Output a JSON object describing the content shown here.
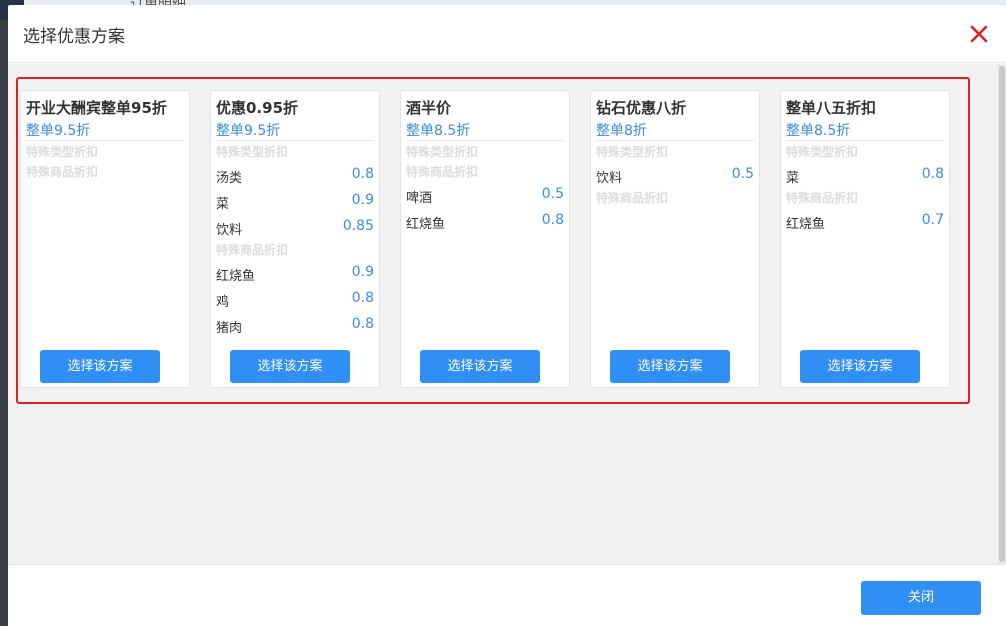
{
  "background": {
    "partial_title": "订单明细"
  },
  "modal": {
    "title": "选择优惠方案",
    "close_button_label": "关闭",
    "select_button_label": "选择该方案",
    "type_section_label": "特殊类型折扣",
    "goods_section_label": "特殊商品折扣"
  },
  "colors": {
    "accent": "#2f8ff5",
    "value_text": "#3b8de6",
    "highlight_frame": "#e02020",
    "close_icon": "#e02020"
  },
  "icons": {
    "close": "close-icon"
  },
  "plans": [
    {
      "name": "开业大酬宾整单95折",
      "overall": "整单9.5折",
      "type_discounts": [],
      "goods_discounts": []
    },
    {
      "name": "优惠0.95折",
      "overall": "整单9.5折",
      "type_discounts": [
        {
          "name": "汤类",
          "value": "0.8"
        },
        {
          "name": "菜",
          "value": "0.9"
        },
        {
          "name": "饮料",
          "value": "0.85"
        }
      ],
      "goods_discounts": [
        {
          "name": "红烧鱼",
          "value": "0.9"
        },
        {
          "name": "鸡",
          "value": "0.8"
        },
        {
          "name": "猪肉",
          "value": "0.8"
        }
      ]
    },
    {
      "name": "酒半价",
      "overall": "整单8.5折",
      "type_discounts": [],
      "goods_discounts": [
        {
          "name": "啤酒",
          "value": "0.5"
        },
        {
          "name": "红烧鱼",
          "value": "0.8"
        }
      ]
    },
    {
      "name": "钻石优惠八折",
      "overall": "整单8折",
      "type_discounts": [
        {
          "name": "饮料",
          "value": "0.5"
        }
      ],
      "goods_discounts": []
    },
    {
      "name": "整单八五折扣",
      "overall": "整单8.5折",
      "type_discounts": [
        {
          "name": "菜",
          "value": "0.8"
        }
      ],
      "goods_discounts": [
        {
          "name": "红烧鱼",
          "value": "0.7"
        }
      ]
    }
  ]
}
